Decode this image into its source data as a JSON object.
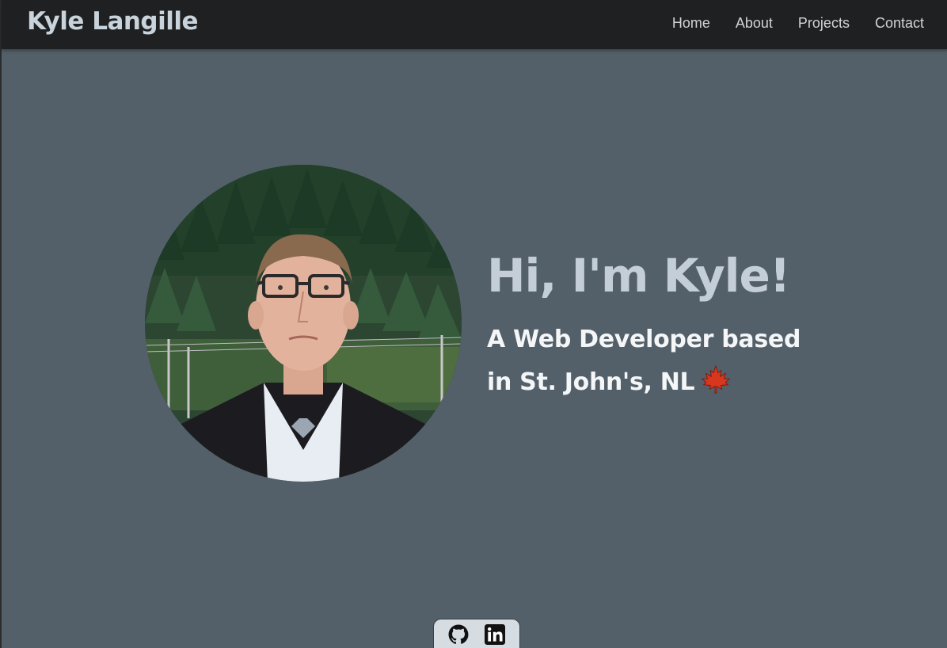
{
  "header": {
    "brand": "Kyle Langille",
    "nav": [
      {
        "label": "Home"
      },
      {
        "label": "About"
      },
      {
        "label": "Projects"
      },
      {
        "label": "Contact"
      }
    ]
  },
  "hero": {
    "title": "Hi, I'm Kyle!",
    "subtitle": "A Web Developer based in St. John's, NL",
    "subtitle_emoji_icon": "maple-leaf-icon",
    "photo_icon": "profile-photo"
  },
  "social": [
    {
      "icon": "github-icon"
    },
    {
      "icon": "linkedin-icon"
    }
  ],
  "colors": {
    "background": "#546069",
    "navbar": "#1f2022",
    "brand_text": "#c9d3db",
    "title_text": "#c3ced8",
    "subtitle_text": "#f4f6f8",
    "social_tab": "#d5dde3"
  }
}
